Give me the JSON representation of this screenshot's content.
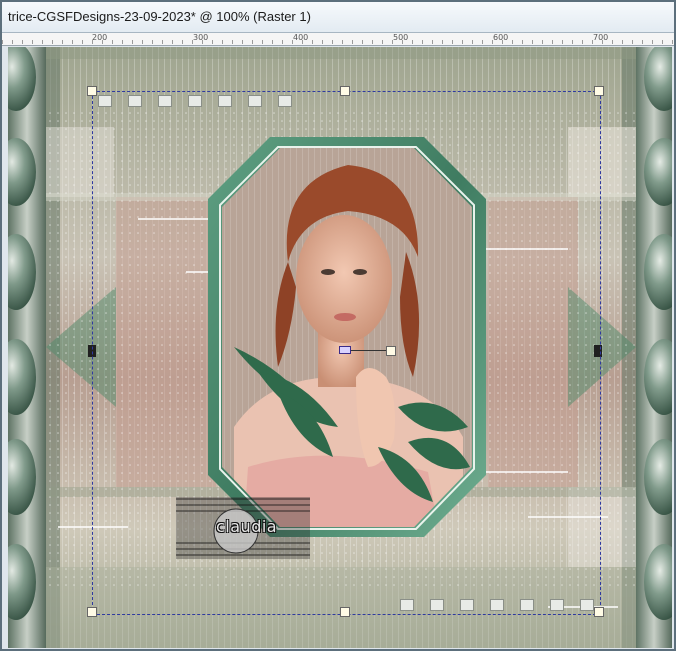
{
  "window": {
    "title": "trice-CGSFDesigns-23-09-2023* @ 100% (Raster 1)"
  },
  "ruler": {
    "labels": [
      "200",
      "300",
      "400",
      "500",
      "600",
      "700"
    ]
  },
  "artwork": {
    "watermark": "claudia"
  },
  "colors": {
    "frame_green": "#4d8d6e",
    "selection_line": "#2f3aa0",
    "ruler_bg": "#f5f5f5"
  }
}
